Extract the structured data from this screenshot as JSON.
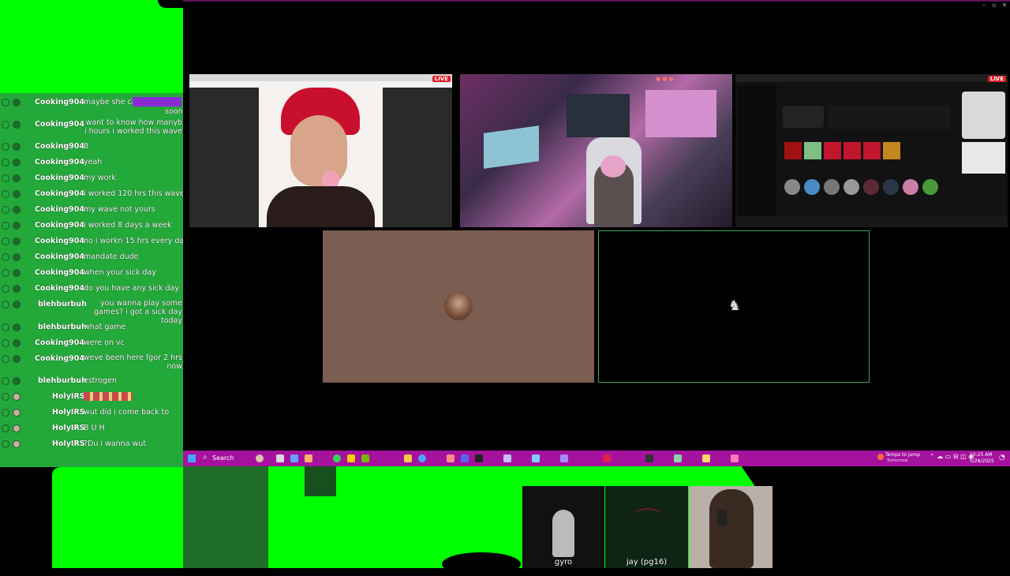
{
  "chat": {
    "messages": [
      {
        "user": "Cooking904",
        "text": "maybe she ca",
        "tail": "soon"
      },
      {
        "user": "Cooking904",
        "text": "want to know how manyb i hours i worked this wave"
      },
      {
        "user": "Cooking904",
        "text": "8"
      },
      {
        "user": "Cooking904",
        "text": "yeah"
      },
      {
        "user": "Cooking904",
        "text": "my work"
      },
      {
        "user": "Cooking904",
        "text": "i worked 120 hrs this wave"
      },
      {
        "user": "Cooking904",
        "text": "my wave not yours"
      },
      {
        "user": "Cooking904",
        "text": "i worked 8 days a week"
      },
      {
        "user": "Cooking904",
        "text": "no i workn 15 hrs every day"
      },
      {
        "user": "Cooking904",
        "text": "mandate dude"
      },
      {
        "user": "Cooking904",
        "text": "when your sick day"
      },
      {
        "user": "Cooking904",
        "text": "do you have any sick day"
      },
      {
        "user": "blehburbuh",
        "text": "you wanna play some games? i got a sick day today"
      },
      {
        "user": "blehburbuh",
        "text": "what game"
      },
      {
        "user": "Cooking904",
        "text": "were on vc"
      },
      {
        "user": "Cooking904",
        "text": "weve been here fgor 2 hrs now"
      },
      {
        "user": "blehburbuh",
        "text": "estrogen"
      },
      {
        "user": "HolyIRS",
        "text": ""
      },
      {
        "user": "HolyIRS",
        "text": "wut did i come back to"
      },
      {
        "user": "HolyIRS",
        "text": "B U H"
      },
      {
        "user": "HolyIRS",
        "text": "?Du i wanna wut"
      }
    ]
  },
  "streams": {
    "live_badge": "LIVE"
  },
  "taskbar": {
    "search_placeholder": "Search",
    "weather": "Temps to jump",
    "weather_sub": "Tomorrow",
    "time": "10:25 AM",
    "date": "5/28/2025"
  },
  "participants": [
    {
      "name": "gyro"
    },
    {
      "name": "jay (pg16)"
    }
  ],
  "colors": {
    "green_screen": "#00ff00",
    "chat_bg": "#23a83a",
    "taskbar": "#a4129e",
    "live": "#e01b24",
    "speaking_border": "#3ba55d"
  }
}
